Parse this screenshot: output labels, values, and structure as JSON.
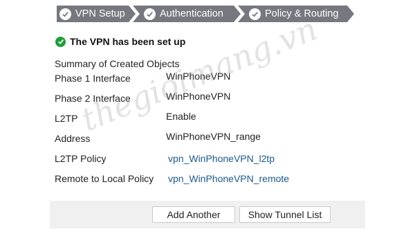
{
  "wizard": {
    "steps": [
      {
        "label": "VPN Setup",
        "state": "complete"
      },
      {
        "label": "Authentication",
        "state": "complete"
      },
      {
        "label": "Policy & Routing",
        "state": "complete"
      }
    ],
    "step_color": "#75797f"
  },
  "status": {
    "icon": "check-circle-icon",
    "message": "The VPN has been set up",
    "color": "#1f9e3c"
  },
  "summary": {
    "title": "Summary of Created Objects",
    "rows": [
      {
        "label": "Phase 1 Interface",
        "value": "WinPhoneVPN",
        "is_link": false
      },
      {
        "label": "Phase 2 Interface",
        "value": "WinPhoneVPN",
        "is_link": false
      },
      {
        "label": "L2TP",
        "value": "Enable",
        "is_link": false
      },
      {
        "label": "Address",
        "value": "WinPhoneVPN_range",
        "is_link": false
      },
      {
        "label": "L2TP Policy",
        "value": "vpn_WinPhoneVPN_l2tp",
        "is_link": true
      },
      {
        "label": "Remote to Local Policy",
        "value": "vpn_WinPhoneVPN_remote",
        "is_link": true
      }
    ],
    "link_color": "#1a5a8a"
  },
  "actions": {
    "add_another": "Add Another",
    "show_tunnel_list": "Show Tunnel List"
  },
  "watermark": "thegioimang.vn"
}
